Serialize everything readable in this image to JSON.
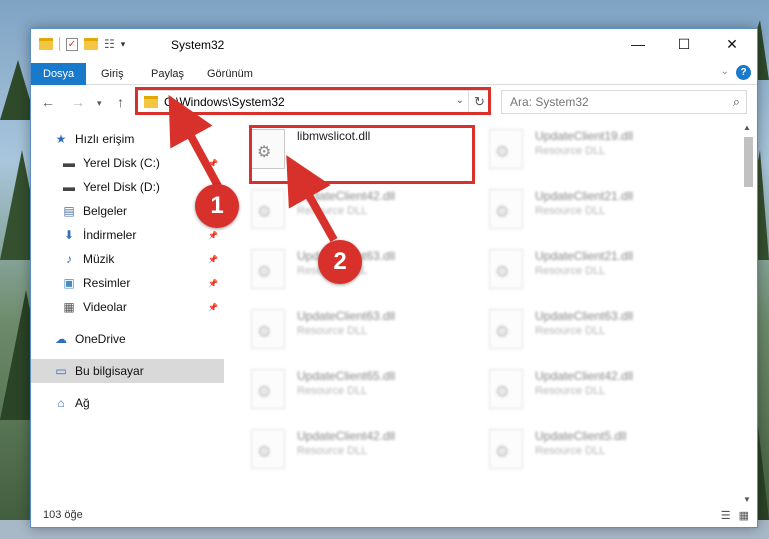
{
  "window": {
    "title": "System32"
  },
  "ribbon": {
    "tabs": [
      "Dosya",
      "Giriş",
      "Paylaş",
      "Görünüm"
    ],
    "help_glyph": "?"
  },
  "address_bar": {
    "path": "C:\\Windows\\System32",
    "search_placeholder": "Ara: System32"
  },
  "sidebar": {
    "items": [
      {
        "label": "Hızlı erişim",
        "icon": "star-icon",
        "pinned": false
      },
      {
        "label": "Yerel Disk (C:)",
        "icon": "drive-icon",
        "pinned": true
      },
      {
        "label": "Yerel Disk (D:)",
        "icon": "drive-icon",
        "pinned": true
      },
      {
        "label": "Belgeler",
        "icon": "document-icon",
        "pinned": true
      },
      {
        "label": "İndirmeler",
        "icon": "download-icon",
        "pinned": true
      },
      {
        "label": "Müzik",
        "icon": "music-icon",
        "pinned": true
      },
      {
        "label": "Resimler",
        "icon": "pictures-icon",
        "pinned": true
      },
      {
        "label": "Videolar",
        "icon": "video-icon",
        "pinned": true
      },
      {
        "label": "OneDrive",
        "icon": "cloud-icon",
        "pinned": false
      },
      {
        "label": "Bu bilgisayar",
        "icon": "computer-icon",
        "pinned": false,
        "selected": true
      },
      {
        "label": "Ağ",
        "icon": "network-icon",
        "pinned": false
      }
    ]
  },
  "files": [
    {
      "name": "libmwslicot.dll",
      "type": "",
      "highlighted": true
    },
    {
      "name": "UpdateClient19.dll",
      "type": "Resource DLL"
    },
    {
      "name": "UpdateClient42.dll",
      "type": "Resource DLL"
    },
    {
      "name": "UpdateClient21.dll",
      "type": "Resource DLL"
    },
    {
      "name": "UpdateClient63.dll",
      "type": "Resource DLL"
    },
    {
      "name": "UpdateClient21.dll",
      "type": "Resource DLL"
    },
    {
      "name": "UpdateClient63.dll",
      "type": "Resource DLL"
    },
    {
      "name": "UpdateClient63.dll",
      "type": "Resource DLL"
    },
    {
      "name": "UpdateClient65.dll",
      "type": "Resource DLL"
    },
    {
      "name": "UpdateClient42.dll",
      "type": "Resource DLL"
    },
    {
      "name": "UpdateClient42.dll",
      "type": "Resource DLL"
    },
    {
      "name": "UpdateClient5.dll",
      "type": "Resource DLL"
    }
  ],
  "status": {
    "item_count": "103 öğe"
  },
  "annotations": {
    "step1": "1",
    "step2": "2",
    "color": "#d8302a"
  }
}
